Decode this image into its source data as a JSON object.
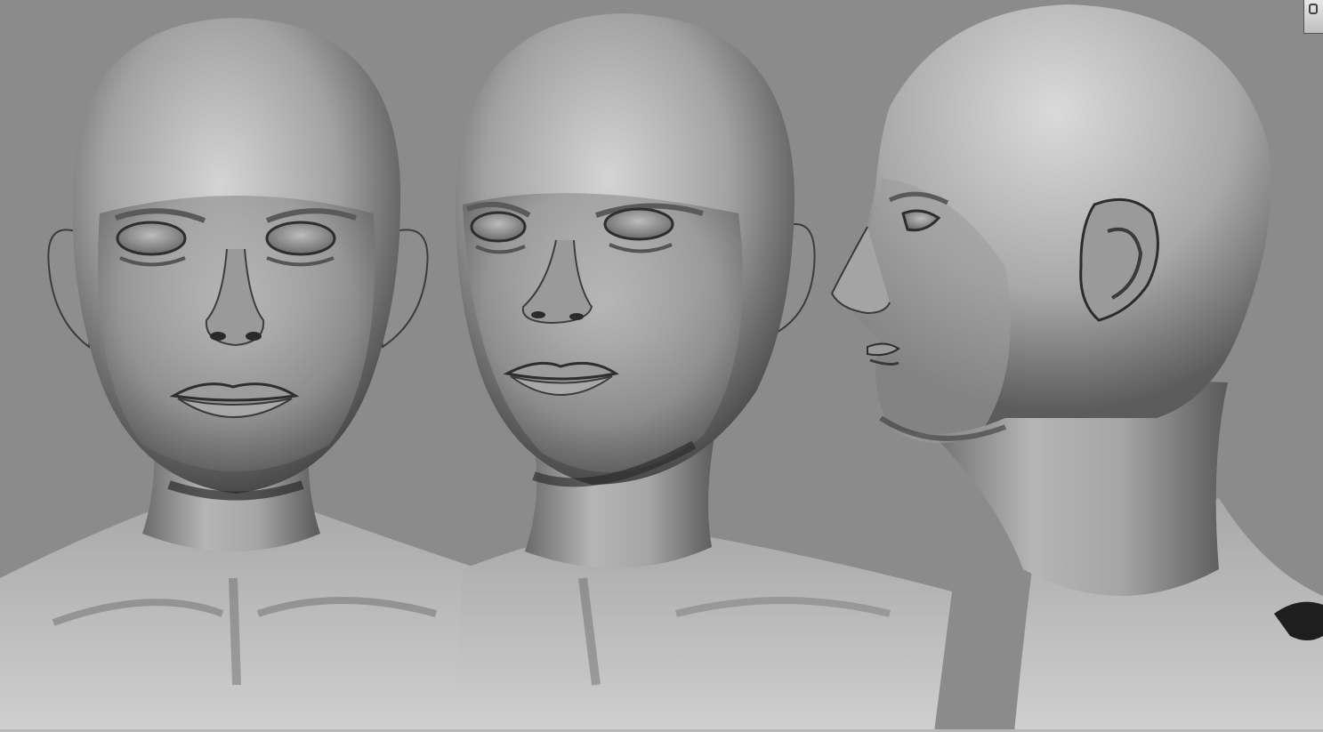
{
  "viewport": {
    "background": "#8b8b8b",
    "clay_light": "#d6d6d6",
    "clay_mid": "#9c9c9c",
    "clay_dark": "#2a2a2a"
  },
  "views": [
    {
      "name": "front-view",
      "angle": "front"
    },
    {
      "name": "three-quarter-view",
      "angle": "three-quarter"
    },
    {
      "name": "profile-view",
      "angle": "side"
    }
  ],
  "corner_widget": {
    "icon": "viewport-gizmo-icon"
  }
}
